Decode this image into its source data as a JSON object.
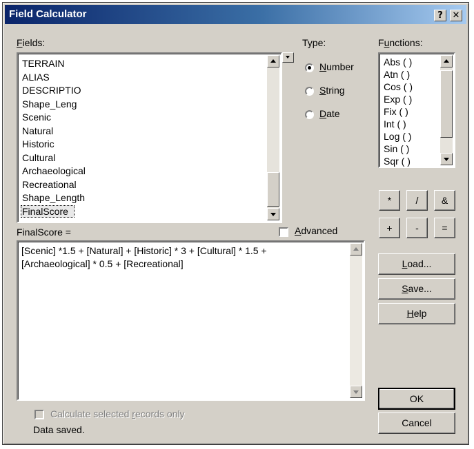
{
  "window": {
    "title": "Field Calculator",
    "help_btn": "?",
    "close_btn": "✕"
  },
  "fields": {
    "label_prefix": "F",
    "label_rest": "ields:",
    "items": [
      "TERRAIN",
      "ALIAS",
      "DESCRIPTIO",
      "Shape_Leng",
      "Scenic",
      "Natural",
      "Historic",
      "Cultural",
      "Archaeological",
      "Recreational",
      "Shape_Length",
      "FinalScore"
    ],
    "selected": "FinalScore"
  },
  "type": {
    "label": "Type:",
    "options": [
      {
        "pre": "",
        "ul": "N",
        "post": "umber",
        "checked": true
      },
      {
        "pre": "",
        "ul": "S",
        "post": "tring",
        "checked": false
      },
      {
        "pre": "",
        "ul": "D",
        "post": "ate",
        "checked": false
      }
    ]
  },
  "functions": {
    "label_prefix": "F",
    "label_ul": "u",
    "label_rest": "nctions:",
    "items": [
      "Abs ( )",
      "Atn ( )",
      "Cos ( )",
      "Exp ( )",
      "Fix ( )",
      "Int ( )",
      "Log ( )",
      "Sin ( )",
      "Sqr ( )"
    ]
  },
  "operators": [
    "*",
    "/",
    "&",
    "+",
    "-",
    "="
  ],
  "expression": {
    "label": "FinalScore =",
    "text": "[Scenic] *1.5 + [Natural] + [Historic] * 3 + [Cultural] * 1.5 +\n[Archaeological] * 0.5 + [Recreational]"
  },
  "advanced": {
    "ul": "A",
    "rest": "dvanced"
  },
  "buttons": {
    "load": {
      "ul": "L",
      "rest": "oad..."
    },
    "save": {
      "ul": "S",
      "rest": "ave..."
    },
    "help": {
      "ul": "H",
      "rest": "elp"
    },
    "ok": "OK",
    "cancel": "Cancel"
  },
  "calc_selected": {
    "pre": "Calculate selected ",
    "ul": "r",
    "post": "ecords only"
  },
  "status": "Data saved."
}
